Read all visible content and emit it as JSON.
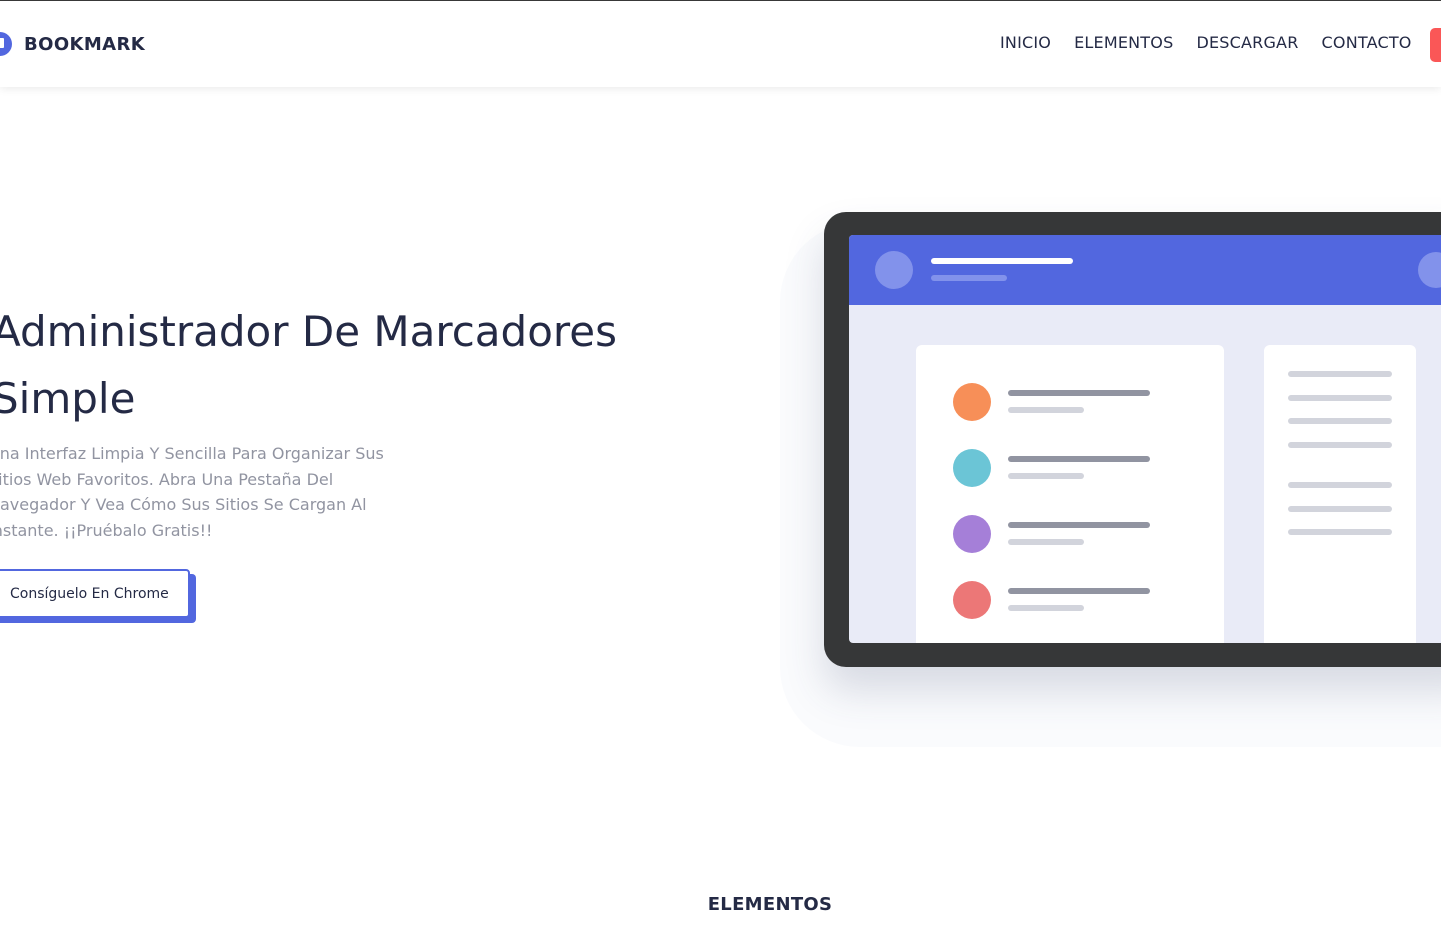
{
  "brand": {
    "name": "BOOKMARK",
    "accent_color": "#5267df",
    "cta_color": "#fa5757"
  },
  "nav": {
    "items": [
      {
        "label": "INICIO"
      },
      {
        "label": "ELEMENTOS"
      },
      {
        "label": "DESCARGAR"
      },
      {
        "label": "CONTACTO"
      }
    ]
  },
  "hero": {
    "title": "Administrador De Marcadores Simple",
    "description": "Una Interfaz Limpia Y Sencilla Para Organizar Sus Sitios Web Favoritos. Abra Una Pestaña Del Navegador Y Vea Cómo Sus Sitios Se Cargan Al Instante. ¡¡Pruébalo Gratis!!",
    "button_label": "Consíguelo En Chrome"
  },
  "illustration": {
    "list_dot_colors": [
      "#f78f58",
      "#6bc5d6",
      "#a57fd8",
      "#ec7777"
    ]
  },
  "section": {
    "label": "ELEMENTOS"
  }
}
